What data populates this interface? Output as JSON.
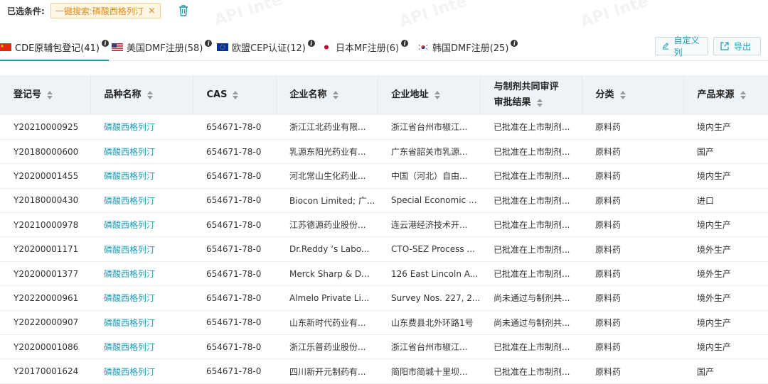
{
  "filter": {
    "label": "已选条件:",
    "chip_text": "一键搜索:磷酸西格列汀",
    "chip_close": "×"
  },
  "watermarks": [
    "API Inte",
    "API Inte",
    "API Inte"
  ],
  "tabs": [
    {
      "label": "CDE原辅包登记(41)",
      "flag": "cn-flag-icon",
      "active": true
    },
    {
      "label": "美国DMF注册(58)",
      "flag": "us-flag-icon",
      "active": false
    },
    {
      "label": "欧盟CEP认证(12)",
      "flag": "eu-flag-icon",
      "active": false
    },
    {
      "label": "日本MF注册(6)",
      "flag": "jp-flag-icon",
      "active": false
    },
    {
      "label": "韩国DMF注册(25)",
      "flag": "kr-flag-icon",
      "active": false
    }
  ],
  "toolbar": {
    "custom_label": "自定义列",
    "export_label": "导出"
  },
  "table": {
    "columns": [
      "登记号",
      "品种名称",
      "CAS",
      "企业名称",
      "企业地址",
      "与制剂共同审评审批结果",
      "分类",
      "产品来源"
    ],
    "rows": [
      [
        "Y20210000925",
        "磷酸西格列汀",
        "654671-78-0",
        "浙江江北药业有限...",
        "浙江省台州市椒江...",
        "已批准在上市制剂...",
        "原料药",
        "境内生产"
      ],
      [
        "Y20180000600",
        "磷酸西格列汀",
        "654671-78-0",
        "乳源东阳光药业有...",
        "广东省韶关市乳源...",
        "已批准在上市制剂...",
        "原料药",
        "国产"
      ],
      [
        "Y20200001455",
        "磷酸西格列汀",
        "654671-78-0",
        "河北常山生化药业...",
        "中国（河北）自由...",
        "已批准在上市制剂...",
        "原料药",
        "境内生产"
      ],
      [
        "Y20180000430",
        "磷酸西格列汀",
        "654671-78-0",
        "Biocon Limited; 广...",
        "Special Economic ...",
        "已批准在上市制剂...",
        "原料药",
        "进口"
      ],
      [
        "Y20210000978",
        "磷酸西格列汀",
        "654671-78-0",
        "江苏德源药业股份...",
        "连云港经济技术开...",
        "已批准在上市制剂...",
        "原料药",
        "境内生产"
      ],
      [
        "Y20200001171",
        "磷酸西格列汀",
        "654671-78-0",
        "Dr.Reddy ’s Labo...",
        "CTO-SEZ Process ...",
        "已批准在上市制剂...",
        "原料药",
        "境外生产"
      ],
      [
        "Y20200001377",
        "磷酸西格列汀",
        "654671-78-0",
        "Merck Sharp & D...",
        "126 East Lincoln A...",
        "已批准在上市制剂...",
        "原料药",
        "境外生产"
      ],
      [
        "Y20220000961",
        "磷酸西格列汀",
        "654671-78-0",
        "Almelo Private Li...",
        "Survey Nos. 227, 2...",
        "尚未通过与制剂共...",
        "原料药",
        "境外生产"
      ],
      [
        "Y20220000907",
        "磷酸西格列汀",
        "654671-78-0",
        "山东新时代药业有...",
        "山东费县北外环路1号",
        "尚未通过与制剂共...",
        "原料药",
        "境内生产"
      ],
      [
        "Y20200001086",
        "磷酸西格列汀",
        "654671-78-0",
        "浙江乐普药业股份...",
        "浙江省台州市椒江...",
        "已批准在上市制剂...",
        "原料药",
        "境内生产"
      ],
      [
        "Y20170001624",
        "磷酸西格列汀",
        "654671-78-0",
        "四川新开元制药有...",
        "简阳市简城十里坝...",
        "已批准在上市制剂...",
        "原料药",
        "国产"
      ]
    ]
  },
  "colors": {
    "accent": "#1a9bb5",
    "chip_bg": "#fff7e6",
    "chip_text": "#e08a1a",
    "header_bg": "#eef3f7"
  }
}
